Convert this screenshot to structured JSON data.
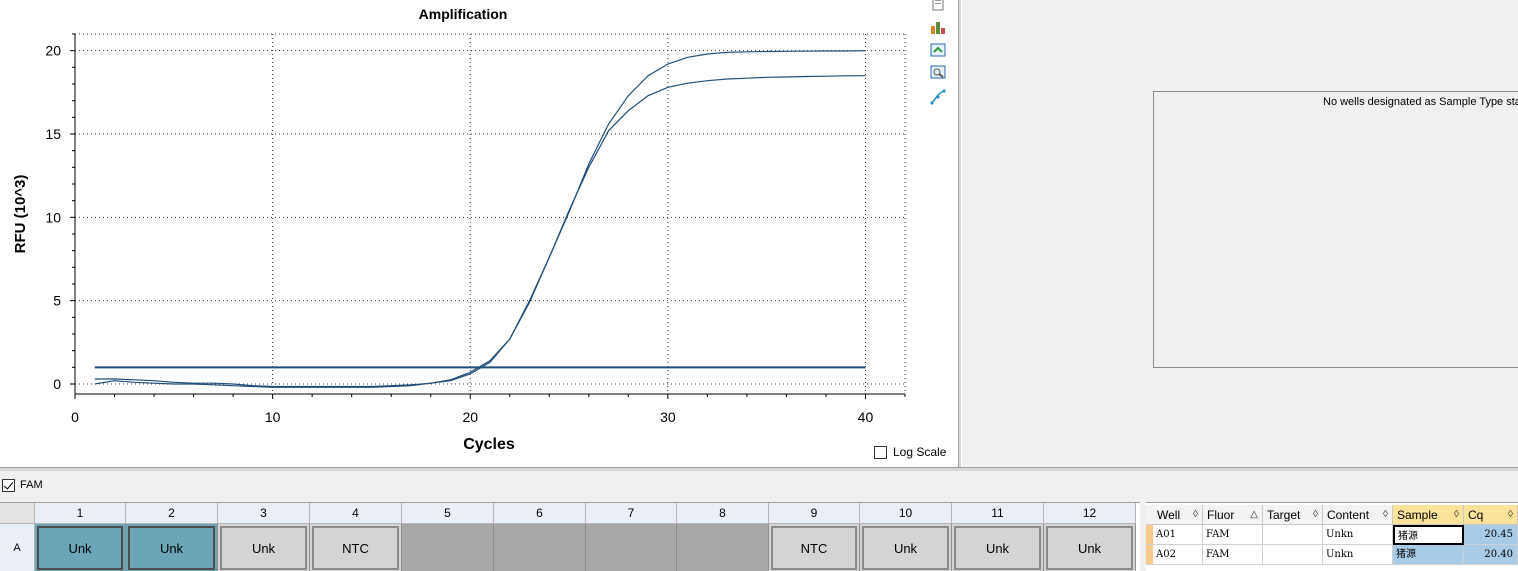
{
  "chart_data": {
    "type": "line",
    "title": "Amplification",
    "xlabel": "Cycles",
    "ylabel": "RFU (10^3)",
    "xlim": [
      0,
      42
    ],
    "ylim": [
      -0.6,
      21
    ],
    "x_ticks": [
      "0",
      "10",
      "20",
      "30",
      "40"
    ],
    "y_ticks": [
      "0",
      "5",
      "10",
      "15",
      "20"
    ],
    "grid": true,
    "series": [
      {
        "color": "#1f4e79",
        "x": [
          1,
          2,
          3,
          4,
          5,
          6,
          7,
          8,
          9,
          10,
          11,
          12,
          13,
          14,
          15,
          16,
          17,
          18,
          19,
          20,
          21,
          22,
          23,
          24,
          25,
          26,
          27,
          28,
          29,
          30,
          31,
          32,
          33,
          34,
          35,
          36,
          37,
          38,
          39,
          40
        ],
        "y": [
          0.0,
          0.2,
          0.1,
          0.05,
          0.0,
          0.0,
          -0.05,
          -0.1,
          -0.15,
          -0.2,
          -0.2,
          -0.2,
          -0.2,
          -0.2,
          -0.2,
          -0.15,
          -0.1,
          0.05,
          0.25,
          0.7,
          1.4,
          2.7,
          4.9,
          7.6,
          10.4,
          13.0,
          15.2,
          16.4,
          17.3,
          17.8,
          18.05,
          18.2,
          18.3,
          18.35,
          18.4,
          18.42,
          18.45,
          18.47,
          18.49,
          18.5
        ]
      },
      {
        "color": "#1f4e79",
        "x": [
          1,
          2,
          3,
          4,
          5,
          6,
          7,
          8,
          9,
          10,
          11,
          12,
          13,
          14,
          15,
          16,
          17,
          18,
          19,
          20,
          21,
          22,
          23,
          24,
          25,
          26,
          27,
          28,
          29,
          30,
          31,
          32,
          33,
          34,
          35,
          36,
          37,
          38,
          39,
          40
        ],
        "y": [
          0.3,
          0.3,
          0.25,
          0.2,
          0.1,
          0.05,
          0.05,
          0.0,
          -0.1,
          -0.15,
          -0.15,
          -0.15,
          -0.15,
          -0.15,
          -0.15,
          -0.1,
          -0.05,
          0.05,
          0.2,
          0.6,
          1.3,
          2.7,
          5.0,
          7.6,
          10.3,
          13.2,
          15.6,
          17.3,
          18.5,
          19.2,
          19.6,
          19.8,
          19.9,
          19.93,
          19.95,
          19.96,
          19.97,
          19.98,
          19.98,
          20.0
        ]
      }
    ],
    "threshold": {
      "x": [
        1,
        40
      ],
      "y": 1.0,
      "color": "#1f4e79"
    }
  },
  "chart_tools": [
    "copy-icon",
    "chart-settings-icon",
    "export-icon",
    "zoom-icon",
    "curve-fit-icon"
  ],
  "log_scale": {
    "label": "Log Scale",
    "checked": false
  },
  "standard_curve": {
    "message": "No wells designated as Sample Type standard"
  },
  "fluor_filter": {
    "label": "FAM",
    "checked": true
  },
  "plate": {
    "row_label": "A",
    "columns": [
      "1",
      "2",
      "3",
      "4",
      "5",
      "6",
      "7",
      "8",
      "9",
      "10",
      "11",
      "12"
    ],
    "wells": [
      {
        "label": "Unk",
        "state": "selected"
      },
      {
        "label": "Unk",
        "state": "selected"
      },
      {
        "label": "Unk",
        "state": "filled"
      },
      {
        "label": "NTC",
        "state": "filled"
      },
      {
        "label": "",
        "state": "empty"
      },
      {
        "label": "",
        "state": "empty"
      },
      {
        "label": "",
        "state": "empty"
      },
      {
        "label": "",
        "state": "empty"
      },
      {
        "label": "NTC",
        "state": "filled"
      },
      {
        "label": "Unk",
        "state": "filled"
      },
      {
        "label": "Unk",
        "state": "filled"
      },
      {
        "label": "Unk",
        "state": "filled"
      }
    ]
  },
  "results": {
    "headers": [
      "Well",
      "Fluor",
      "Target",
      "Content",
      "Sample",
      "Cq"
    ],
    "sort_glyphs": [
      "◊",
      "△",
      "◊",
      "◊",
      "◊",
      "◊"
    ],
    "rows": [
      {
        "well": "A01",
        "fluor": "FAM",
        "target": "",
        "content": "Unkn",
        "sample": "猪源",
        "cq": "20.45"
      },
      {
        "well": "A02",
        "fluor": "FAM",
        "target": "",
        "content": "Unkn",
        "sample": "猪源",
        "cq": "20.40"
      }
    ]
  }
}
